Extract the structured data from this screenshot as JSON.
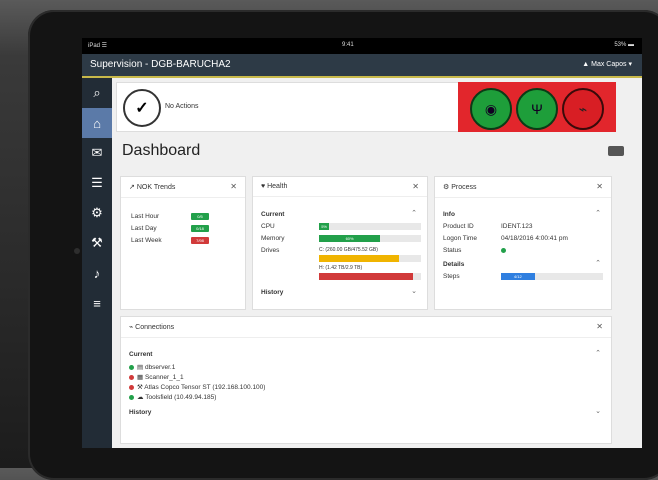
{
  "status_bar": {
    "left": "iPad ☰",
    "time": "9:41",
    "battery": "53% ▬"
  },
  "topbar": {
    "title": "Supervision - DGB-BARUCHA2",
    "user": "▲ Max Capos ▾"
  },
  "alerts": {
    "message": "No Actions"
  },
  "dashboard": {
    "title": "Dashboard"
  },
  "nok": {
    "title": "NOK Trends",
    "rows": [
      {
        "label": "Last Hour",
        "value": "0/5",
        "color": "#22a04a"
      },
      {
        "label": "Last Day",
        "value": "0/18",
        "color": "#22a04a"
      },
      {
        "label": "Last Week",
        "value": "7/98",
        "color": "#d13a3a"
      }
    ]
  },
  "health": {
    "title": "Health",
    "current_label": "Current",
    "cpu_label": "CPU",
    "cpu_value": "5%",
    "cpu_fraction": 0.1,
    "memory_label": "Memory",
    "memory_value": "60%",
    "memory_fraction": 0.6,
    "drives_label": "Drives",
    "drive1_text": "C: (260.00 GB/475.52 GB)",
    "drive1_fraction": 0.78,
    "drive2_text": "H: (1.42 TB/2.9 TB)",
    "drive2_fraction": 0.92,
    "history_label": "History"
  },
  "process": {
    "title": "Process",
    "info_label": "Info",
    "product_label": "Product ID",
    "product_value": "IDENT.123",
    "logon_label": "Logon Time",
    "logon_value": "04/18/2016 4:00:41 pm",
    "status_label": "Status",
    "details_label": "Details",
    "steps_label": "Steps",
    "steps_value": "4/12",
    "steps_fraction": 0.33
  },
  "connections": {
    "title": "Connections",
    "current_label": "Current",
    "items": [
      {
        "text": "dbserver.1",
        "color": "#22a04a",
        "icon": "server-icon"
      },
      {
        "text": "Scanner_1_1",
        "color": "#d13a3a",
        "icon": "scanner-icon"
      },
      {
        "text": "Atlas Copco Tensor ST (192.168.100.100)",
        "color": "#d13a3a",
        "icon": "wrench-icon"
      },
      {
        "text": "Toolsfield (10.49.94.185)",
        "color": "#22a04a",
        "icon": "cloud-icon"
      }
    ],
    "history_label": "History"
  },
  "colors": {
    "accent": "#5b7aa8",
    "danger": "#e2262c",
    "success": "#1e9e3a",
    "topbar": "#2d3a46"
  }
}
